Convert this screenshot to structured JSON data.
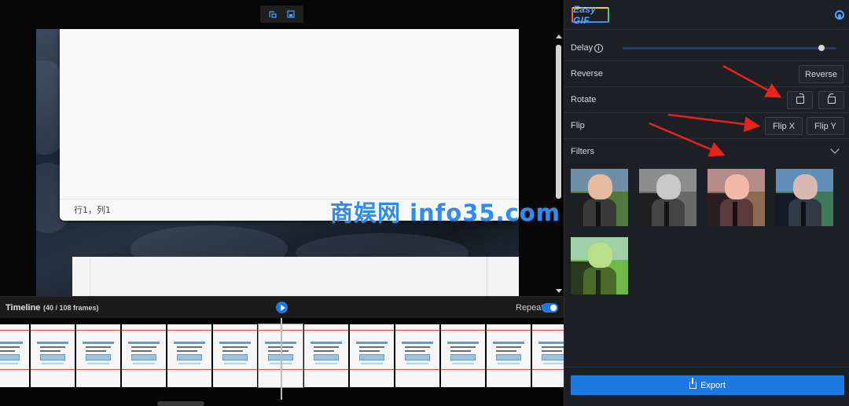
{
  "app": {
    "logo_text": "Easy GIF"
  },
  "document_preview": {
    "status_text": "行1，列1"
  },
  "timeline": {
    "title": "Timeline",
    "frames_info": "(40 / 108 frames)",
    "current_frame": 40,
    "total_frames": 108,
    "repeat_label": "Repeat",
    "repeat_on": true
  },
  "settings": {
    "delay_label": "Delay",
    "delay_level": 0.93,
    "reverse_label": "Reverse",
    "reverse_button": "Reverse",
    "rotate_label": "Rotate",
    "flip_label": "Flip",
    "flip_x_button": "Flip X",
    "flip_y_button": "Flip Y",
    "filters_label": "Filters"
  },
  "filters": [
    {
      "name": "original",
      "sky": "#6f8fa8",
      "grass": "#4f7a3a",
      "seat": "#1c1e22",
      "face": "#e6bca1",
      "body": "#3a3a3a",
      "strap": "#111111"
    },
    {
      "name": "grayscale",
      "sky": "#8d8d8d",
      "grass": "#6a6a6a",
      "seat": "#1f1f1f",
      "face": "#c9c9c9",
      "body": "#444444",
      "strap": "#141414"
    },
    {
      "name": "warm",
      "sky": "#b58c88",
      "grass": "#8f6a52",
      "seat": "#2a1e20",
      "face": "#f2b8a8",
      "body": "#5a3a3a",
      "strap": "#1a1010"
    },
    {
      "name": "cool",
      "sky": "#5f8fb8",
      "grass": "#3f7a5a",
      "seat": "#141a24",
      "face": "#d8b8b0",
      "body": "#2f3a44",
      "strap": "#0d1116"
    },
    {
      "name": "green-tint",
      "sky": "#9fd0a8",
      "grass": "#6fb84a",
      "seat": "#2a3a1e",
      "face": "#b8e08a",
      "body": "#4a6a2a",
      "strap": "#1a2a10"
    }
  ],
  "export": {
    "label": "Export"
  },
  "watermark": {
    "text": "商娱网 info35.com"
  },
  "colors": {
    "accent": "#1e7ae0",
    "panel_bg": "#1c1f24",
    "arrow": "#e8231c"
  }
}
